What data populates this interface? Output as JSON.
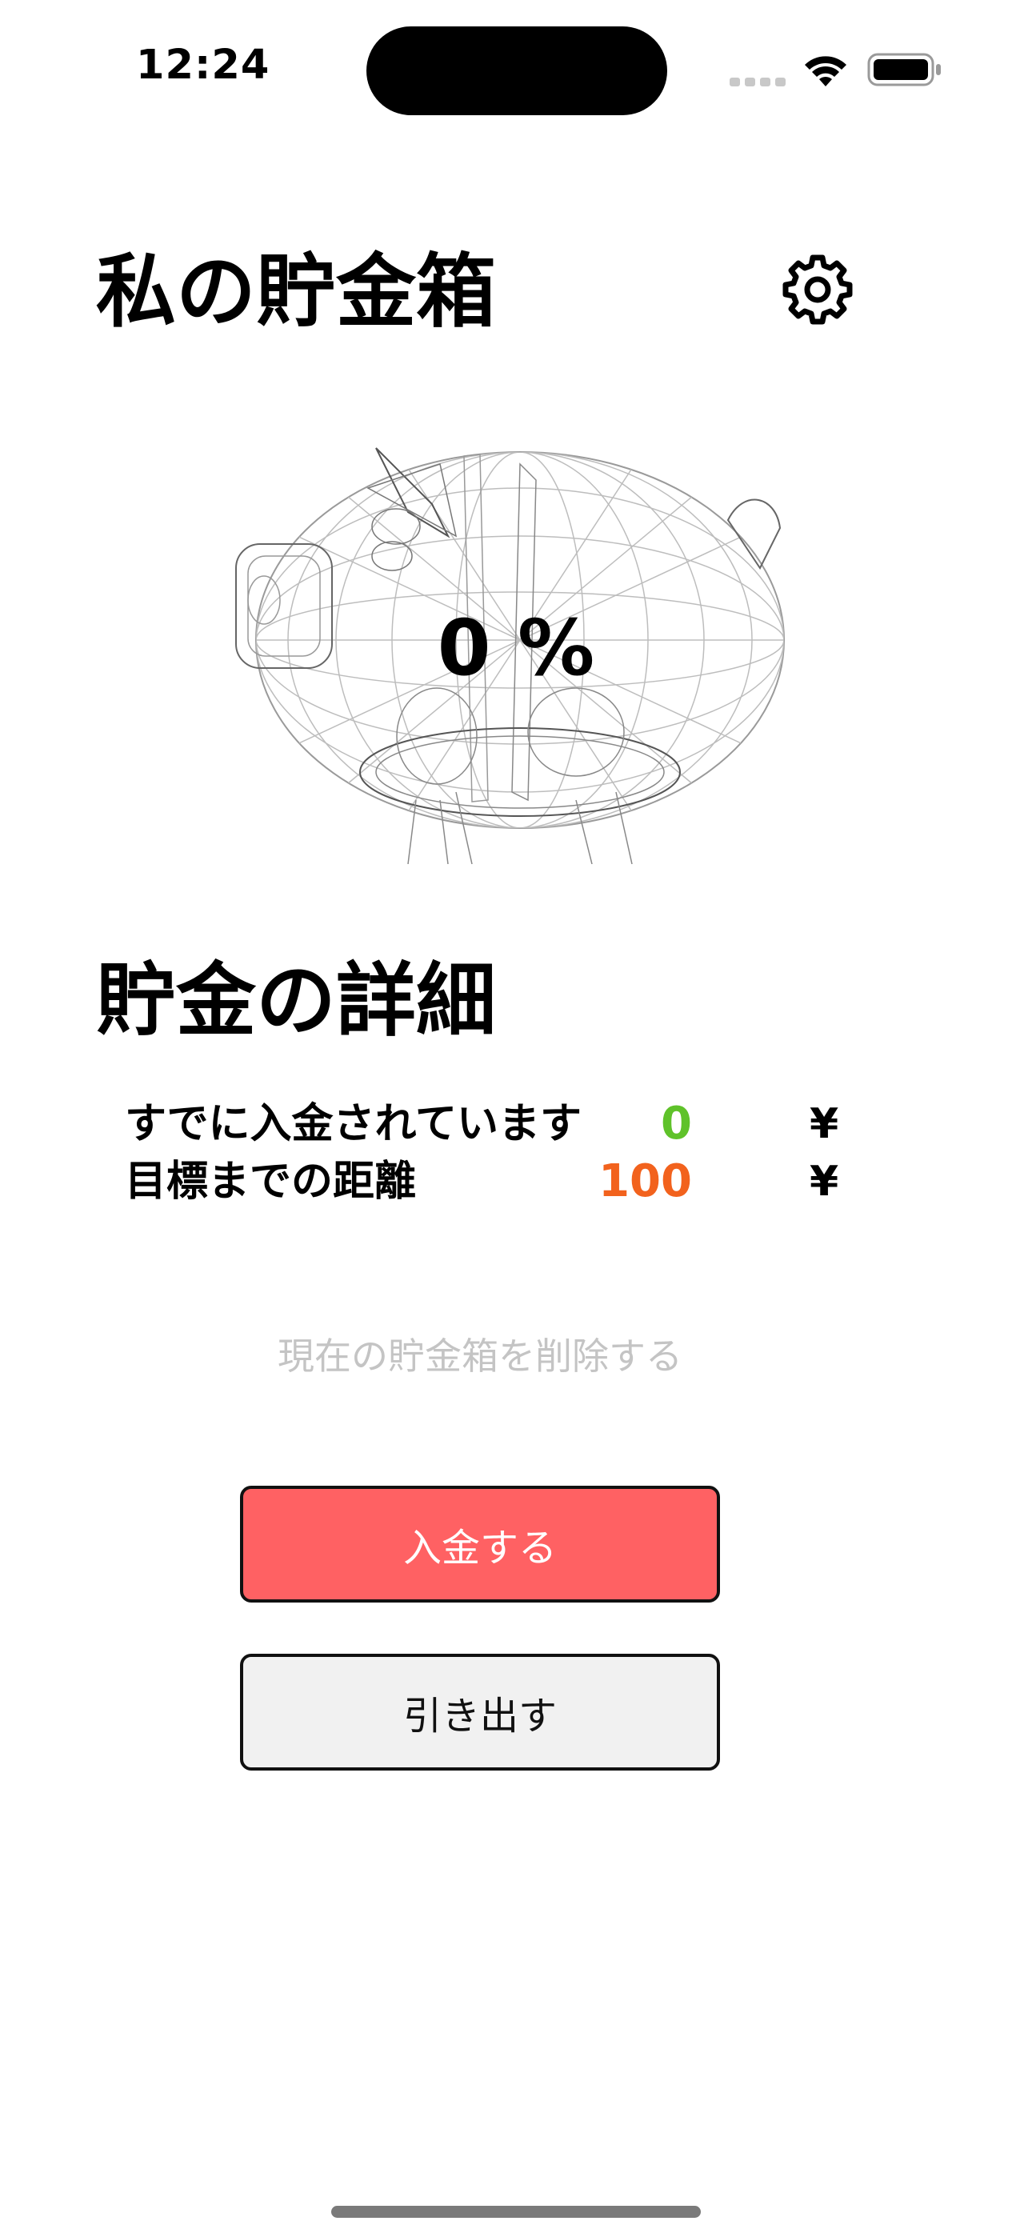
{
  "status_bar": {
    "time": "12:24",
    "icons": [
      "signal-icon",
      "wifi-icon",
      "battery-icon"
    ]
  },
  "header": {
    "title": "私の貯金箱",
    "settings_icon": "gear-icon"
  },
  "piggy_bank": {
    "progress_text": "0 %",
    "progress_value": 0
  },
  "details": {
    "title": "貯金の詳細",
    "rows": [
      {
        "label": "すでに入金されています",
        "value": "0",
        "currency": "¥",
        "value_color": "#5fc22a"
      },
      {
        "label": "目標までの距離",
        "value": "100",
        "currency": "¥",
        "value_color": "#f2621d"
      }
    ]
  },
  "actions": {
    "delete_label": "現在の貯金箱を削除する",
    "deposit_label": "入金する",
    "withdraw_label": "引き出す"
  },
  "colors": {
    "deposit_button": "#ff6163",
    "withdraw_button": "#f1f1f1",
    "delete_text": "#c4c4c4"
  }
}
